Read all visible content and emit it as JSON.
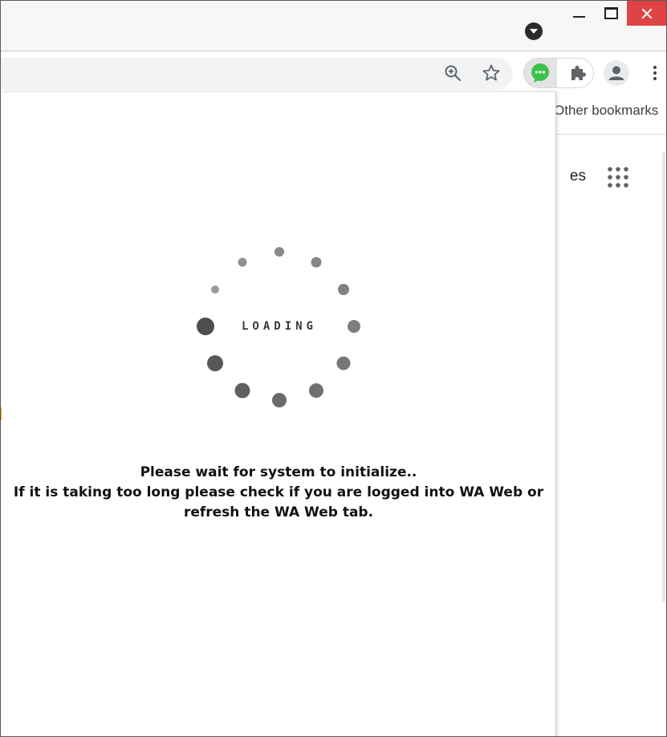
{
  "browser": {
    "bookmarks": {
      "other_label": "Other bookmarks"
    },
    "background_page": {
      "partial_link": "es"
    },
    "colors": {
      "close_button": "#e04343",
      "extension_chat": "#3ec14c",
      "omnibox": "#f1f3f4"
    }
  },
  "popup": {
    "loading_label": "LOADING",
    "message": {
      "line1": "Please wait for system to initialize..",
      "line2": "If it is taking too long please check if you are logged into WA Web or refresh the WA Web tab."
    }
  }
}
